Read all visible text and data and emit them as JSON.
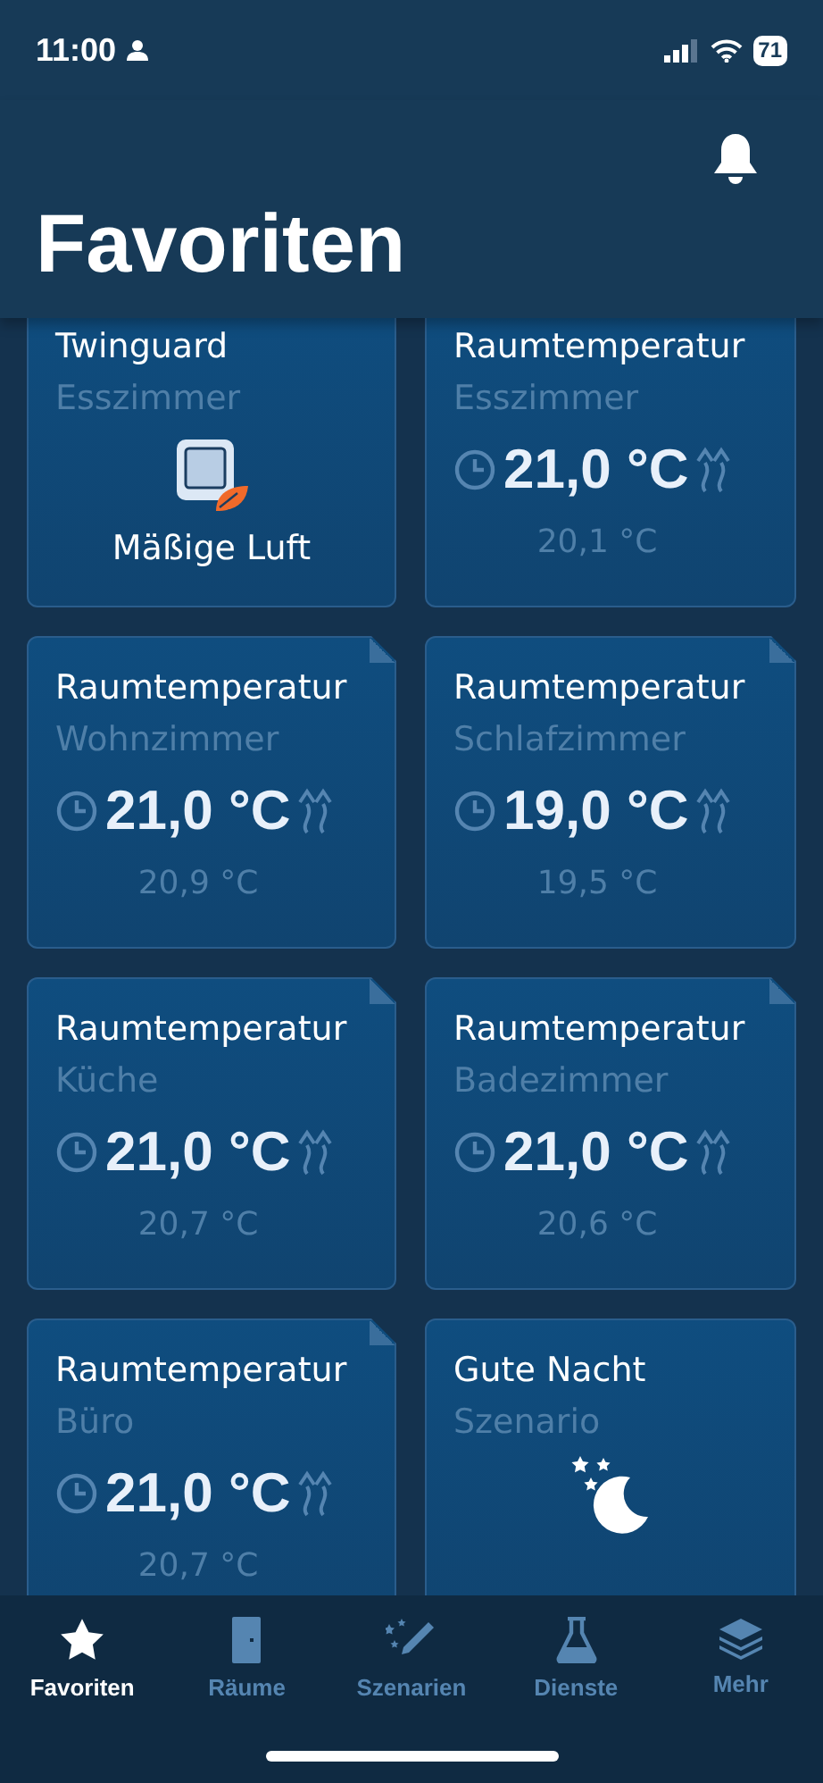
{
  "status_bar": {
    "time": "11:00",
    "battery": "71"
  },
  "header": {
    "title": "Favoriten"
  },
  "cards": [
    {
      "kind": "air",
      "title": "Twinguard",
      "subtitle": "Esszimmer",
      "status": "Mäßige Luft"
    },
    {
      "kind": "thermostat",
      "title": "Raumtemperatur",
      "subtitle": "Esszimmer",
      "setpoint": "21,0 °C",
      "current": "20,1 °C"
    },
    {
      "kind": "thermostat",
      "title": "Raumtemperatur",
      "subtitle": "Wohnzimmer",
      "setpoint": "21,0 °C",
      "current": "20,9 °C",
      "folded": true
    },
    {
      "kind": "thermostat",
      "title": "Raumtemperatur",
      "subtitle": "Schlafzimmer",
      "setpoint": "19,0 °C",
      "current": "19,5 °C",
      "folded": true
    },
    {
      "kind": "thermostat",
      "title": "Raumtemperatur",
      "subtitle": "Küche",
      "setpoint": "21,0 °C",
      "current": "20,7 °C",
      "folded": true
    },
    {
      "kind": "thermostat",
      "title": "Raumtemperatur",
      "subtitle": "Badezimmer",
      "setpoint": "21,0 °C",
      "current": "20,6 °C",
      "folded": true
    },
    {
      "kind": "thermostat",
      "title": "Raumtemperatur",
      "subtitle": "Büro",
      "setpoint": "21,0 °C",
      "current": "20,7 °C",
      "folded": true
    },
    {
      "kind": "scenario",
      "title": "Gute Nacht",
      "subtitle": "Szenario"
    }
  ],
  "tabs": [
    {
      "label": "Favoriten",
      "kind": "star",
      "selected": true
    },
    {
      "label": "Räume",
      "kind": "door",
      "selected": false
    },
    {
      "label": "Szenarien",
      "kind": "wand",
      "selected": false
    },
    {
      "label": "Dienste",
      "kind": "flask",
      "selected": false
    },
    {
      "label": "Mehr",
      "kind": "layers",
      "selected": false
    }
  ]
}
